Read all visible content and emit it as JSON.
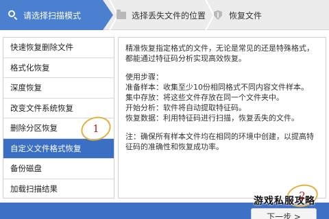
{
  "steps": [
    {
      "label": "请选择扫描模式",
      "icon": "search-icon"
    },
    {
      "label": "选择丢失文件的位置",
      "icon": "folder-icon"
    },
    {
      "label": "恢复文件",
      "icon": "shield-icon"
    }
  ],
  "menu": {
    "items": [
      {
        "label": "快速恢复删除文件"
      },
      {
        "label": "格式化恢复"
      },
      {
        "label": "深度恢复"
      },
      {
        "label": "改变文件系统恢复"
      },
      {
        "label": "删除分区恢复"
      },
      {
        "label": "自定义文件格式恢复"
      },
      {
        "label": "备份磁盘"
      },
      {
        "label": "加载扫描结果"
      }
    ],
    "active_label": "自定义文件格式恢复"
  },
  "description": {
    "intro": "精准恢复指定格式的文件，无论是常见的还是特殊格式，都能通过特征码分析实现高效恢复。",
    "steps_title": "使用步骤：",
    "step_lines": [
      "准备样本：收集至少10份相同格式不同内容文件样本。",
      "集中存放：将这些文件存放在同一个文件夹中。",
      "开始分析：软件将自动提取特征码。",
      "恢复数据：利用特征码进行扫描，恢复丢失的文件。"
    ],
    "note": "注：确保所有样本文件均在相同的环境中创建，以提高特征码的准确性和恢复成功率。"
  },
  "callouts": {
    "first": "1",
    "second": "2"
  },
  "footer": {
    "next_label": "下一步 >"
  },
  "watermark": "游戏私服攻略",
  "colors": {
    "accent": "#4a80cf",
    "active_row": "#3a6fc4",
    "footer": "#3f72c6",
    "callout_ring": "#e0b040",
    "callout_text": "#b01e1e"
  }
}
